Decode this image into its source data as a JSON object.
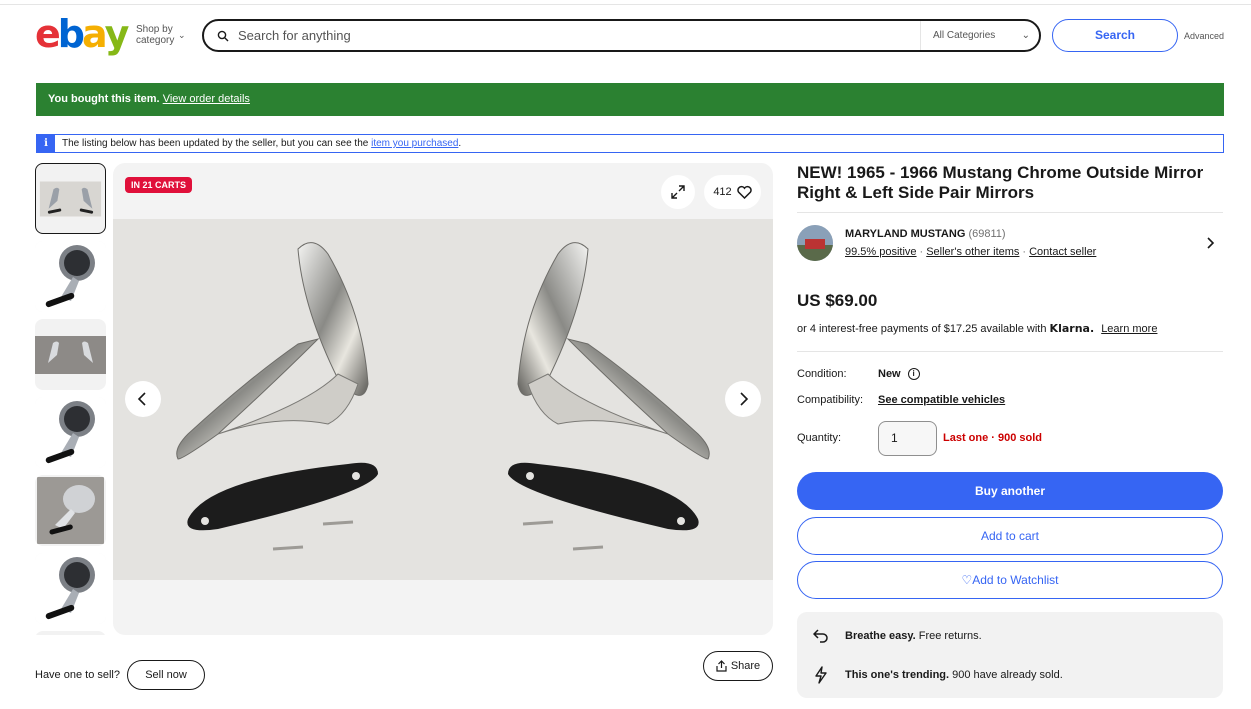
{
  "header": {
    "logo_letters": [
      "e",
      "b",
      "a",
      "y"
    ],
    "shop_by_line1": "Shop by",
    "shop_by_line2": "category",
    "search_placeholder": "Search for anything",
    "category_select": "All Categories",
    "search_button": "Search",
    "advanced_link": "Advanced"
  },
  "banner": {
    "bought_text": "You bought this item.",
    "view_order_link": "View order details"
  },
  "notice": {
    "icon_letter": "i",
    "text_before": "The listing below has been updated by the seller, but you can see the",
    "link": "item you purchased",
    "text_after": "."
  },
  "gallery": {
    "carts_badge": "IN 21 CARTS",
    "watch_count": "412",
    "sell_prompt": "Have one to sell?",
    "sell_button": "Sell now",
    "share_button": "Share"
  },
  "listing": {
    "title": "NEW! 1965 - 1966 Mustang Chrome Outside Mirror Right & Left Side Pair Mirrors",
    "seller": {
      "name": "MARYLAND MUSTANG",
      "feedback_count": "(69811)",
      "positive": "99.5% positive",
      "other_items": "Seller's other items",
      "contact": "Contact seller"
    },
    "price": "US $69.00",
    "installments_text": "or 4 interest-free payments of $17.25 available with",
    "klarna_brand": "Klarna.",
    "learn_more": "Learn more",
    "condition_label": "Condition:",
    "condition_value": "New",
    "compatibility_label": "Compatibility:",
    "compatibility_link": "See compatible vehicles",
    "quantity_label": "Quantity:",
    "quantity_value": "1",
    "quantity_note": "Last one · 900 sold",
    "buy_button": "Buy another",
    "cart_button": "Add to cart",
    "watch_button": "Add to Watchlist"
  },
  "perks": [
    {
      "icon": "return-icon",
      "bold": "Breathe easy.",
      "text": "Free returns."
    },
    {
      "icon": "lightning-icon",
      "bold": "This one's trending.",
      "text": "900 have already sold."
    }
  ],
  "colors": {
    "accent_blue": "#3665f3",
    "banner_green": "#2b8131",
    "badge_red": "#e0103a",
    "logo_red": "#e53238",
    "logo_blue": "#0064d2",
    "logo_yellow": "#f5af02",
    "logo_green": "#86b817"
  }
}
